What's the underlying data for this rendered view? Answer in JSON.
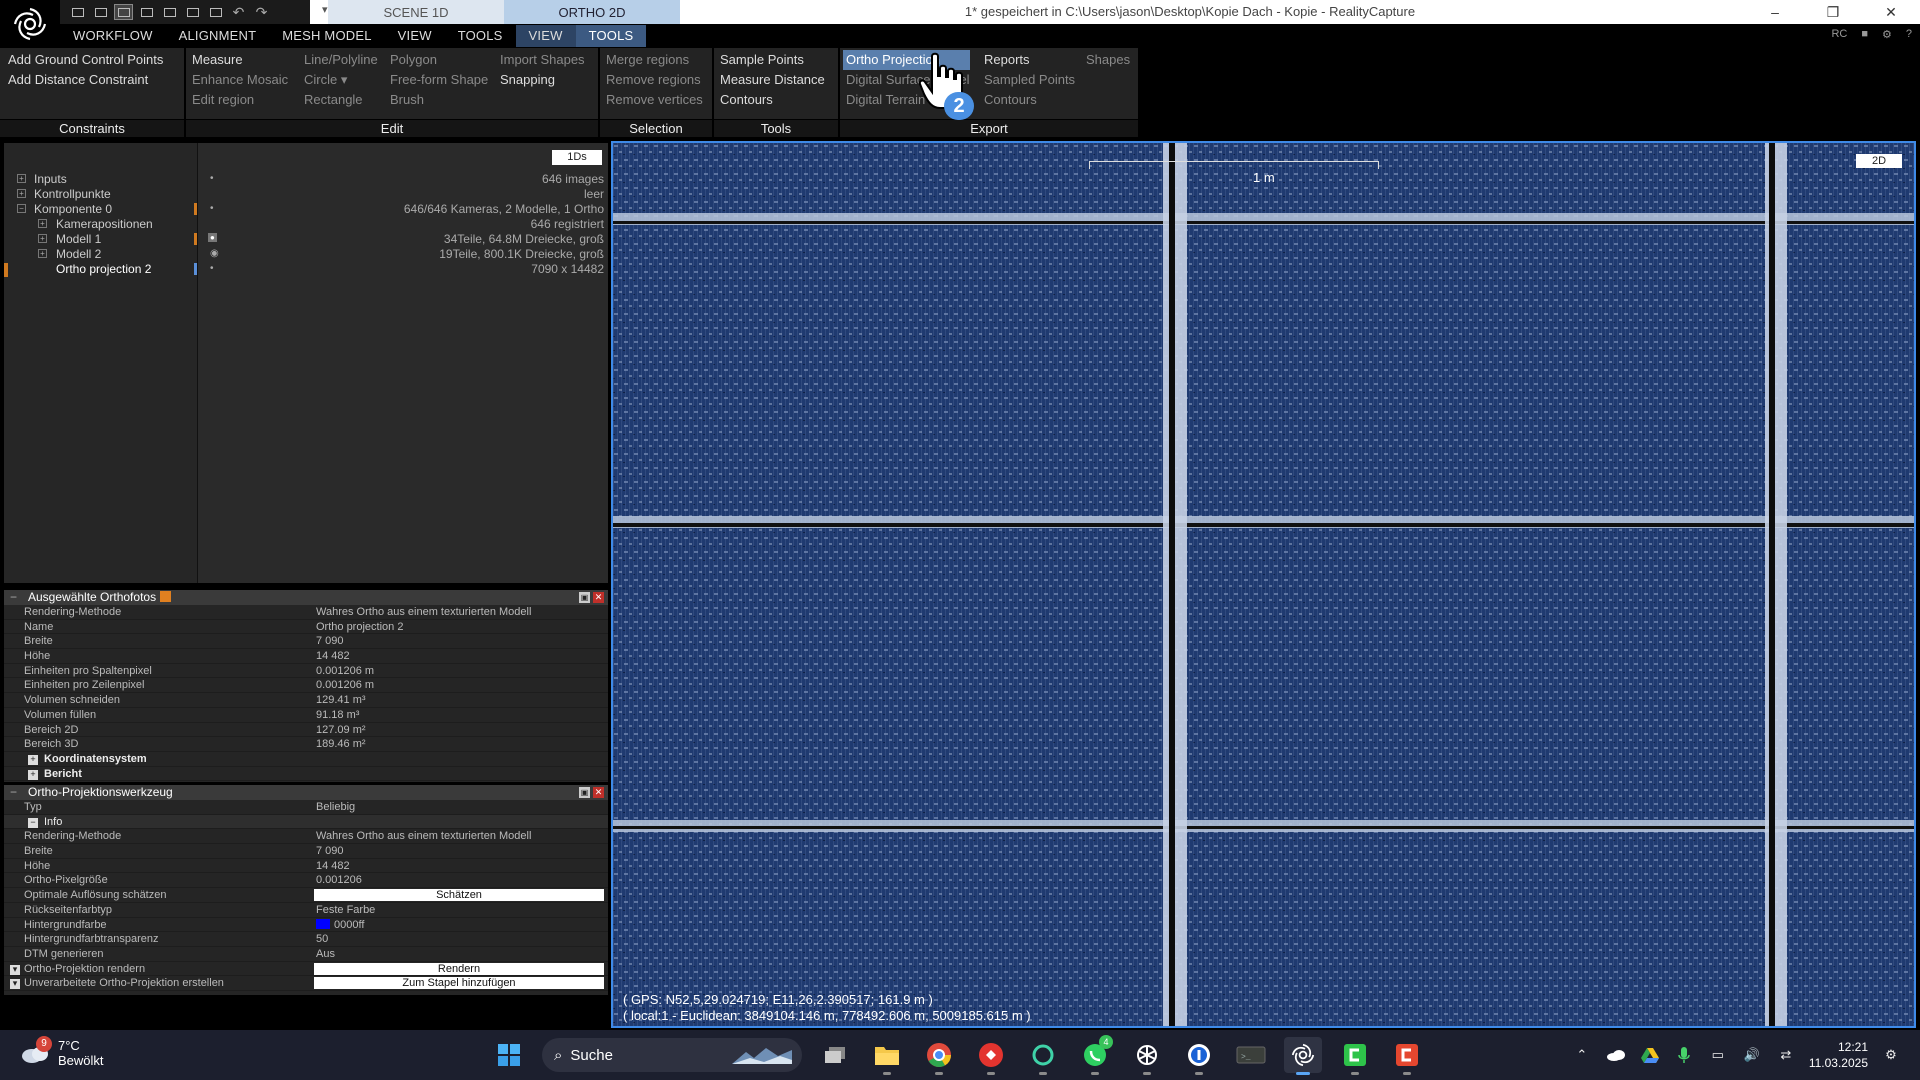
{
  "titlebar": {
    "scene_tabs": [
      "SCENE 1D",
      "ORTHO 2D"
    ],
    "title": "1* gespeichert in C:\\Users\\jason\\Desktop\\Kopie Dach - Kopie - RealityCapture",
    "minimize_icon": "minimize-icon",
    "restore_icon": "restore-icon",
    "close_icon": "close-icon"
  },
  "menu": {
    "items": [
      "WORKFLOW",
      "ALIGNMENT",
      "MESH MODEL",
      "VIEW",
      "TOOLS",
      "VIEW",
      "TOOLS"
    ],
    "active_index": 6,
    "right": {
      "rc": "RC"
    }
  },
  "ribbon": {
    "constraints": {
      "label": "Constraints",
      "col1": [
        "Add Ground Control Points",
        "Add Distance Constraint"
      ]
    },
    "edit": {
      "label": "Edit",
      "col1": [
        "Measure",
        "Enhance Mosaic",
        "Edit region"
      ],
      "col2": [
        "Line/Polyline",
        "Circle  ▾",
        "Rectangle"
      ],
      "col3": [
        "Polygon",
        "Free-form Shape",
        "Brush"
      ],
      "col4": [
        "Import Shapes",
        "Snapping"
      ]
    },
    "selection": {
      "label": "Selection",
      "col1": [
        "Merge regions",
        "Remove regions",
        "Remove vertices"
      ]
    },
    "tools": {
      "label": "Tools",
      "col1": [
        "Sample Points",
        "Measure Distance",
        "Contours"
      ]
    },
    "export": {
      "label": "Export",
      "col1": [
        "Ortho Projection",
        "Digital Surface Model",
        "Digital Terrain Model"
      ],
      "col2": [
        "Reports",
        "Sampled Points",
        "Contours"
      ],
      "col3": [
        "Shapes"
      ]
    }
  },
  "tree": {
    "badge": "1Ds",
    "rows": [
      {
        "name": "Inputs",
        "value": "646 images",
        "indent": 0,
        "pin": true
      },
      {
        "name": "Kontrollpunkte",
        "value": "leer",
        "indent": 0
      },
      {
        "name": "Komponente 0",
        "value": "646/646 Kameras, 2 Modelle, 1 Ortho",
        "indent": 0,
        "pin": true
      },
      {
        "name": "Kamerapositionen",
        "value": "646 registriert",
        "indent": 1
      },
      {
        "name": "Modell 1",
        "value": "34Teile, 64.8M Dreiecke, groß",
        "indent": 1
      },
      {
        "name": "Modell 2",
        "value": "19Teile, 800.1K Dreiecke, groß",
        "indent": 1
      },
      {
        "name": "Ortho projection 2",
        "value": "7090 x 14482",
        "indent": 1,
        "pin": true
      }
    ]
  },
  "panel1": {
    "title": "Ausgewählte Orthofotos",
    "rows": [
      {
        "k": "Rendering-Methode",
        "v": "Wahres Ortho aus einem texturierten Modell"
      },
      {
        "k": "Name",
        "v": "Ortho projection 2"
      },
      {
        "k": "Breite",
        "v": "7 090"
      },
      {
        "k": "Höhe",
        "v": "14 482"
      },
      {
        "k": "Einheiten pro Spaltenpixel",
        "v": "0.001206 m"
      },
      {
        "k": "Einheiten pro Zeilenpixel",
        "v": "0.001206 m"
      },
      {
        "k": "Volumen schneiden",
        "v": "129.41 m³"
      },
      {
        "k": "Volumen füllen",
        "v": "91.18 m³"
      },
      {
        "k": "Bereich 2D",
        "v": "127.09 m²"
      },
      {
        "k": "Bereich 3D",
        "v": "189.46 m²"
      }
    ],
    "sections": [
      "Koordinatensystem",
      "Bericht"
    ]
  },
  "panel2": {
    "title": "Ortho-Projektionswerkzeug",
    "typ": {
      "k": "Typ",
      "v": "Beliebig"
    },
    "info": "Info",
    "rows": [
      {
        "k": "Rendering-Methode",
        "v": "Wahres Ortho aus einem texturierten Modell"
      },
      {
        "k": "Breite",
        "v": "7 090"
      },
      {
        "k": "Höhe",
        "v": "14 482"
      },
      {
        "k": "Ortho-Pixelgröße",
        "v": "0.001206"
      }
    ],
    "estimate": {
      "k": "Optimale Auflösung schätzen",
      "btn": "Schätzen"
    },
    "rows2": [
      {
        "k": "Rückseitenfarbtyp",
        "v": "Feste Farbe"
      },
      {
        "k": "Hintergrundfarbe",
        "v": "0000ff",
        "color": "#0000ff"
      },
      {
        "k": "Hintergrundfarbtransparenz",
        "v": "50"
      },
      {
        "k": "DTM generieren",
        "v": "Aus"
      }
    ],
    "render": {
      "k": "Ortho-Projektion rendern",
      "btn": "Rendern"
    },
    "batch": {
      "k": "Unverarbeitete Ortho-Projektion erstellen",
      "btn": "Zum Stapel hinzufügen"
    }
  },
  "viewport": {
    "badge": "2D",
    "scale_label": "1 m",
    "gps": "( GPS: N52,5,29.024719; E11,26,2.390517; 161.9 m )",
    "local": "( local:1 - Euclidean: 3849104.146 m, 778492.606 m, 5009185.615 m )",
    "background_color": "#1e3466"
  },
  "cursor": {
    "badge": "2"
  },
  "taskbar": {
    "weather": {
      "badge": "9",
      "temp": "7°C",
      "desc": "Bewölkt"
    },
    "search": "Suche",
    "whatsapp_badge": "4",
    "clock": {
      "time": "12:21",
      "date": "11.03.2025"
    }
  }
}
